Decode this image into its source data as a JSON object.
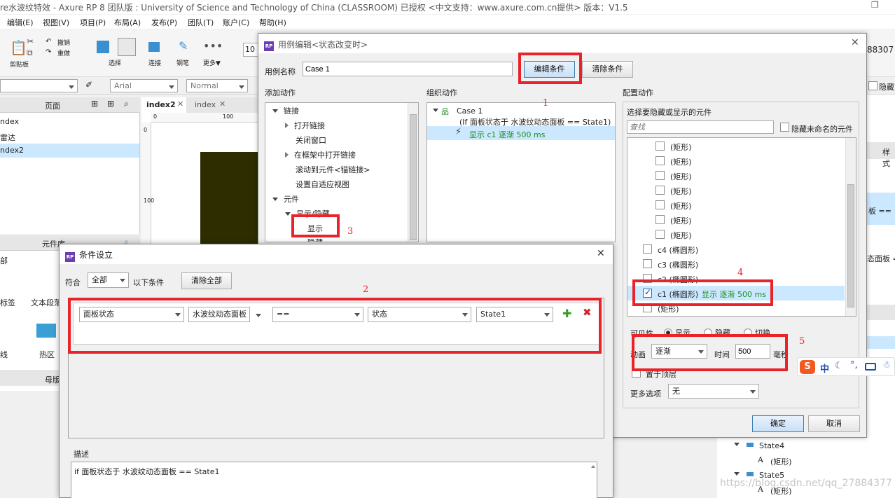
{
  "app": {
    "title": "re水波纹特效 - Axure RP 8 团队版 : University of Science and Technology of China (CLASSROOM) 已授权     <中文支持：www.axure.com.cn提供> 版本：V1.5",
    "menu": [
      "编辑(E)",
      "视图(V)",
      "项目(P)",
      "布局(A)",
      "发布(P)",
      "团队(T)",
      "账户(C)",
      "帮助(H)"
    ],
    "toolbar": {
      "clipboard": "剪贴板",
      "undo": "撤销",
      "redo": "重做",
      "select": "选择",
      "connect": "连接",
      "pen": "钢笔",
      "more": "更多▼",
      "zoom": "10",
      "right_num": "88307"
    },
    "format_bar": {
      "font": "Arial",
      "style": "Normal"
    },
    "pages_panel": {
      "title": "页面",
      "items": [
        "ndex",
        "雷达",
        "ndex2"
      ]
    },
    "widgets_panel": {
      "title": "元件库",
      "tab": "部",
      "items": [
        "标签",
        "文本段落",
        "线",
        "热区"
      ],
      "masters_title": "母版"
    },
    "tabs": [
      "index2",
      "index"
    ],
    "ruler": {
      "h0": "0",
      "h100": "100",
      "v0": "0",
      "v100": "100"
    },
    "right_panel": {
      "style_label": "样式",
      "frag1": "板 ==",
      "frag2": "态面板 ="
    },
    "hide_checkbox_label": "隐藏",
    "ime": {
      "brand": "S",
      "lang": "中"
    },
    "tree_right": [
      "State4",
      "(矩形)",
      "State5",
      "(矩形)"
    ],
    "watermark": "https://blog.csdn.net/qq_27884377"
  },
  "case_editor": {
    "title": "用例编辑<状态改变时>",
    "case_name_label": "用例名称",
    "case_name_value": "Case 1",
    "edit_condition_btn": "编辑条件",
    "clear_condition_btn": "清除条件",
    "add_action": {
      "title": "添加动作",
      "groups": [
        {
          "label": "链接",
          "items": [
            "打开链接",
            "关闭窗口",
            "在框架中打开链接",
            "滚动到元件<锚链接>",
            "设置自适应视图"
          ]
        },
        {
          "label": "元件",
          "sub": "显示/隐藏",
          "items": [
            "显示",
            "隐藏"
          ]
        }
      ]
    },
    "organize_action": {
      "title": "组织动作",
      "case_label": "Case 1",
      "condition": "(If 面板状态于 水波纹动态面板 == State1)",
      "action": "显示 c1 逐渐 500 ms"
    },
    "configure_action": {
      "title": "配置动作",
      "prompt": "选择要隐藏或显示的元件",
      "search_placeholder": "查找",
      "hide_unnamed": "隐藏未命名的元件",
      "items": [
        {
          "label": "(矩形)",
          "checked": false
        },
        {
          "label": "(矩形)",
          "checked": false
        },
        {
          "label": "(矩形)",
          "checked": false
        },
        {
          "label": "(矩形)",
          "checked": false
        },
        {
          "label": "(矩形)",
          "checked": false
        },
        {
          "label": "(矩形)",
          "checked": false
        },
        {
          "label": "(矩形)",
          "checked": false
        },
        {
          "label": "c4 (椭圆形)",
          "checked": false
        },
        {
          "label": "c3 (椭圆形)",
          "checked": false
        },
        {
          "label": "c2 (椭圆形)",
          "checked": false
        },
        {
          "label": "c1 (椭圆形)",
          "checked": true,
          "extra": "显示 逐渐 500 ms"
        },
        {
          "label": "(矩形)",
          "checked": false
        }
      ],
      "visibility_label": "可见性",
      "vis_show": "显示",
      "vis_hide": "隐藏",
      "vis_toggle": "切换",
      "animation_label": "动画",
      "animation_value": "逐渐",
      "time_label": "时间",
      "time_value": "500",
      "ms_label": "毫秒",
      "bring_front": "置于顶层",
      "more_options_label": "更多选项",
      "more_options_value": "无"
    },
    "ok": "确定",
    "cancel": "取消"
  },
  "condition_dialog": {
    "title": "条件设立",
    "match_label": "符合",
    "match_value": "全部",
    "match_suffix": "以下条件",
    "clear_all": "清除全部",
    "condition": {
      "field1": "面板状态",
      "field2": "水波纹动态面板",
      "op": "==",
      "field3": "状态",
      "field4": "State1"
    },
    "desc_label": "描述",
    "desc_text": "if 面板状态于 水波纹动态面板 == State1"
  },
  "annotations": [
    "1",
    "2",
    "3",
    "4",
    "5"
  ],
  "colors": {
    "annotation_red": "#e8232a",
    "selection_blue": "#cce8ff",
    "action_green": "#1e8f1e",
    "logo_purple": "#6d3db2"
  }
}
